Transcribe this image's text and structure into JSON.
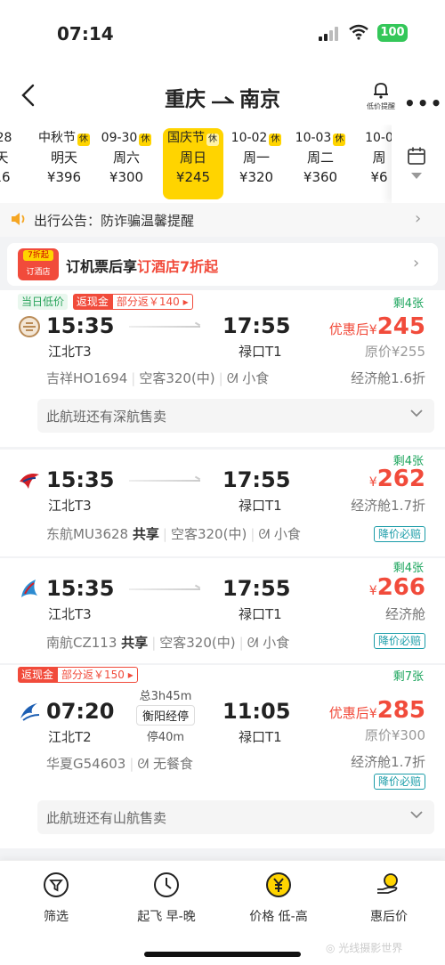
{
  "status": {
    "time": "07:14",
    "battery": "100"
  },
  "header": {
    "from": "重庆",
    "to": "南京",
    "alert_label": "低价提醒"
  },
  "dates": [
    {
      "d1": "-28",
      "d2": "天",
      "d3": "16",
      "holiday": ""
    },
    {
      "d1": "中秋节",
      "d2": "明天",
      "d3": "¥396",
      "holiday": "休"
    },
    {
      "d1": "09-30",
      "d2": "周六",
      "d3": "¥300",
      "holiday": "休"
    },
    {
      "d1": "国庆节",
      "d2": "周日",
      "d3": "¥245",
      "holiday": "休"
    },
    {
      "d1": "10-02",
      "d2": "周一",
      "d3": "¥320",
      "holiday": "休"
    },
    {
      "d1": "10-03",
      "d2": "周二",
      "d3": "¥360",
      "holiday": "休"
    },
    {
      "d1": "10-0",
      "d2": "周",
      "d3": "¥6",
      "holiday": ""
    }
  ],
  "notice": {
    "text": "出行公告：防诈骗温馨提醒"
  },
  "promo": {
    "badge_top": "7折起",
    "badge_bottom": "订酒店",
    "text_prefix": "订机票后享",
    "text_highlight": "订酒店7折起"
  },
  "flights": [
    {
      "tag_low": "当日低价",
      "tag_cash": "返现金",
      "tag_part": "部分返￥140 ▸",
      "left": "剩4张",
      "dep": "15:35",
      "arr": "17:55",
      "dep_ap": "江北T3",
      "arr_ap": "禄口T1",
      "price_prefix": "优惠后",
      "currency": "¥",
      "price": "245",
      "orig": "原价¥255",
      "airline": "吉祥HO1694",
      "share": "",
      "plane": "空客320(中)",
      "meal": "小食",
      "cabin": "经济舱1.6折",
      "down": "",
      "sold": "此航班还有深航售卖"
    },
    {
      "left": "剩4张",
      "dep": "15:35",
      "arr": "17:55",
      "dep_ap": "江北T3",
      "arr_ap": "禄口T1",
      "currency": "¥",
      "price": "262",
      "airline": "东航MU3628",
      "share": "共享",
      "plane": "空客320(中)",
      "meal": "小食",
      "cabin": "经济舱1.7折",
      "down": "降价必赔"
    },
    {
      "left": "剩4张",
      "dep": "15:35",
      "arr": "17:55",
      "dep_ap": "江北T3",
      "arr_ap": "禄口T1",
      "currency": "¥",
      "price": "266",
      "airline": "南航CZ113",
      "share": "共享",
      "plane": "空客320(中)",
      "meal": "小食",
      "cabin": "经济舱",
      "down": "降价必赔"
    },
    {
      "tag_cash": "返现金",
      "tag_part": "部分返￥150 ▸",
      "left": "剩7张",
      "dep": "07:20",
      "arr": "11:05",
      "dep_ap": "江北T2",
      "arr_ap": "禄口T1",
      "total": "总3h45m",
      "stop": "衡阳经停",
      "stop_time": "停40m",
      "price_prefix": "优惠后",
      "currency": "¥",
      "price": "285",
      "orig": "原价¥300",
      "airline": "华夏G54603",
      "meal": "无餐食",
      "cabin": "经济舱1.7折",
      "down": "降价必赔",
      "sold": "此航班还有山航售卖"
    }
  ],
  "bottom_tabs": [
    {
      "label": "筛选"
    },
    {
      "label": "起飞 早-晚"
    },
    {
      "label": "价格 低-高"
    },
    {
      "label": "惠后价"
    }
  ],
  "watermark": "光线摄影世界",
  "colors": {
    "brand_yellow": "#ffd400",
    "price_red": "#f14b3b",
    "green": "#1aa45b"
  }
}
